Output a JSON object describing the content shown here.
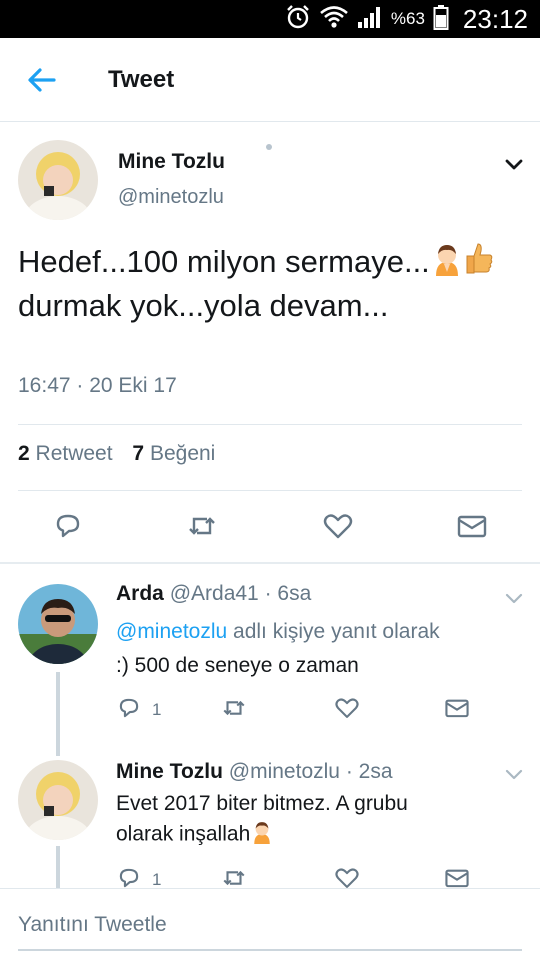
{
  "status_bar": {
    "battery_pct": "%63",
    "time": "23:12",
    "icons": [
      "alarm-icon",
      "wifi-icon",
      "signal-icon",
      "battery-icon"
    ]
  },
  "header": {
    "title": "Tweet",
    "back_icon": "back-arrow-icon"
  },
  "tweet": {
    "author_name": "Mine Tozlu",
    "author_handle": "@minetozlu",
    "text_part1": "Hedef...100 milyon sermaye...",
    "text_part2": " durmak yok...yola devam...",
    "emojis": [
      "praying-person-emoji",
      "thumbs-up-emoji"
    ],
    "timestamp": "16:47 · 20 Eki 17",
    "retweet_count": "2",
    "retweet_label": "Retweet",
    "like_count": "7",
    "like_label": "Beğeni"
  },
  "replies": [
    {
      "name": "Arda",
      "handle": "@Arda41",
      "time": " · 6sa",
      "reply_to_mention": "@minetozlu",
      "reply_to_suffix": " adlı kişiye yanıt olarak",
      "text": ":) 500 de seneye o zaman",
      "reply_count": "1"
    },
    {
      "name": "Mine Tozlu",
      "handle": "@minetozlu",
      "time": " · 2sa",
      "text_line1": "Evet 2017 biter bitmez. A grubu",
      "text_line2": "olarak inşallah",
      "reply_count": "1"
    }
  ],
  "composer": {
    "placeholder": "Yanıtını Tweetle"
  },
  "colors": {
    "accent": "#1da1f2",
    "secondary_text": "#657786",
    "divider": "#e1e8ed"
  }
}
